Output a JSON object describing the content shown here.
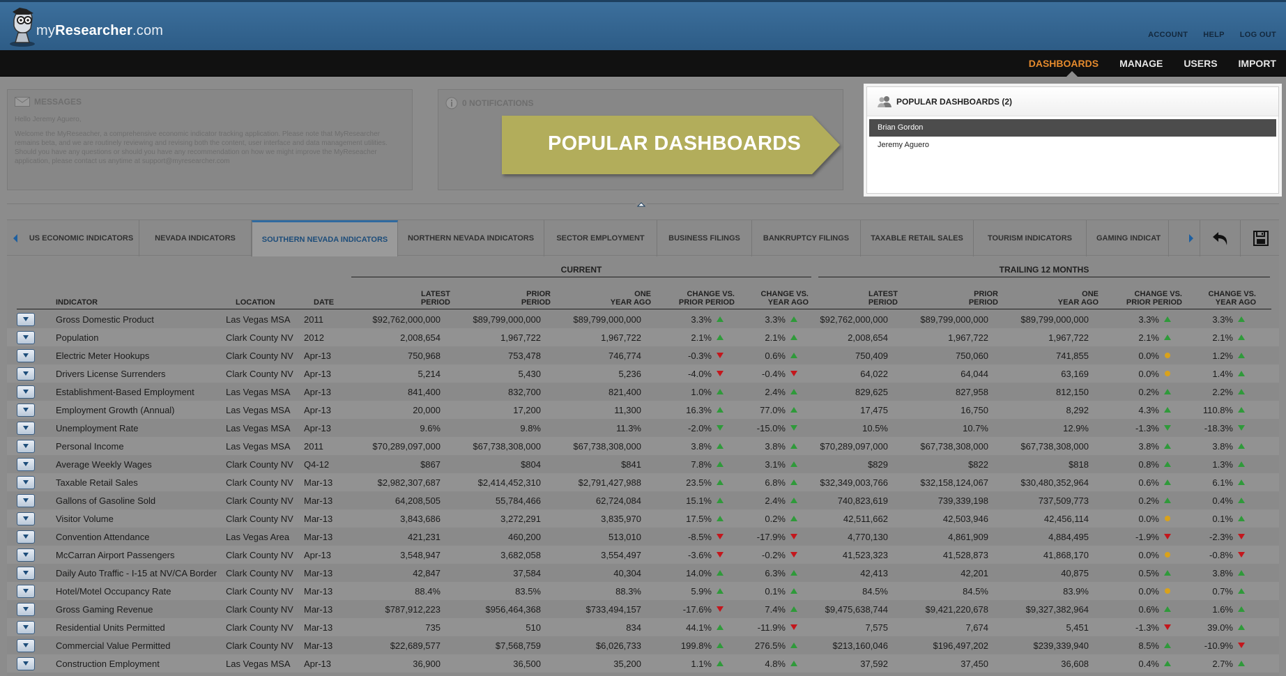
{
  "header": {
    "logo_prefix": "my",
    "logo_brand": "Researcher",
    "logo_suffix": ".com",
    "top_links": [
      "ACCOUNT",
      "HELP",
      "LOG OUT"
    ]
  },
  "nav": {
    "items": [
      "DASHBOARDS",
      "MANAGE",
      "USERS",
      "IMPORT"
    ],
    "active": "DASHBOARDS"
  },
  "messages": {
    "title": "MESSAGES",
    "greeting": "Hello Jeremy Aguero,",
    "body": "Welcome the MyReseacher, a comprehensive economic indicator tracking application. Please note that MyResearcher remains beta, and we are routinely reviewing and revising both the content, user interface and data management utilities. Should you have any questions or should you have any recommendation on how we might improve the MyReseacher application, please contact us anytime at support@myresearcher.com"
  },
  "notifications": {
    "title": "0 NOTIFICATIONS"
  },
  "callout": {
    "text": "POPULAR DASHBOARDS"
  },
  "popular": {
    "title": "POPULAR DASHBOARDS (2)",
    "items": [
      "Brian Gordon",
      "Jeremy Aguero"
    ]
  },
  "tabs": [
    "US ECONOMIC INDICATORS",
    "NEVADA INDICATORS",
    "SOUTHERN NEVADA INDICATORS",
    "NORTHERN NEVADA INDICATORS",
    "SECTOR EMPLOYMENT",
    "BUSINESS FILINGS",
    "BANKRUPTCY FILINGS",
    "TAXABLE RETAIL SALES",
    "TOURISM INDICATORS",
    "GAMING INDICAT"
  ],
  "active_tab": 2,
  "table": {
    "group_current": "CURRENT",
    "group_trailing": "TRAILING 12 MONTHS",
    "columns": {
      "indicator": "INDICATOR",
      "location": "LOCATION",
      "date": "DATE",
      "latest_1": "LATEST",
      "latest_2": "PERIOD",
      "prior_1": "PRIOR",
      "prior_2": "PERIOD",
      "oneyear_1": "ONE",
      "oneyear_2": "YEAR AGO",
      "chgprior_1": "CHANGE VS.",
      "chgprior_2": "PRIOR PERIOD",
      "chgyear_1": "CHANGE VS.",
      "chgyear_2": "YEAR AGO"
    },
    "rows": [
      {
        "name": "Gross Domestic Product",
        "loc": "Las Vegas MSA",
        "date": "2011",
        "c": [
          "$92,762,000,000",
          "$89,799,000,000",
          "$89,799,000,000",
          "3.3%",
          "3.3%"
        ],
        "ci": [
          "up",
          "up"
        ],
        "t": [
          "$92,762,000,000",
          "$89,799,000,000",
          "$89,799,000,000",
          "3.3%",
          "3.3%"
        ],
        "ti": [
          "up",
          "up"
        ]
      },
      {
        "name": "Population",
        "loc": "Clark County NV",
        "date": "2012",
        "c": [
          "2,008,654",
          "1,967,722",
          "1,967,722",
          "2.1%",
          "2.1%"
        ],
        "ci": [
          "up",
          "up"
        ],
        "t": [
          "2,008,654",
          "1,967,722",
          "1,967,722",
          "2.1%",
          "2.1%"
        ],
        "ti": [
          "up",
          "up"
        ]
      },
      {
        "name": "Electric Meter Hookups",
        "loc": "Clark County NV",
        "date": "Apr-13",
        "c": [
          "750,968",
          "753,478",
          "746,774",
          "-0.3%",
          "0.6%"
        ],
        "ci": [
          "down-red",
          "up"
        ],
        "t": [
          "750,409",
          "750,060",
          "741,855",
          "0.0%",
          "1.2%"
        ],
        "ti": [
          "flat",
          "up"
        ]
      },
      {
        "name": "Drivers License Surrenders",
        "loc": "Clark County NV",
        "date": "Apr-13",
        "c": [
          "5,214",
          "5,430",
          "5,236",
          "-4.0%",
          "-0.4%"
        ],
        "ci": [
          "down-red",
          "down-red"
        ],
        "t": [
          "64,022",
          "64,044",
          "63,169",
          "0.0%",
          "1.4%"
        ],
        "ti": [
          "flat",
          "up"
        ]
      },
      {
        "name": "Establishment-Based Employment",
        "loc": "Las Vegas MSA",
        "date": "Apr-13",
        "c": [
          "841,400",
          "832,700",
          "821,400",
          "1.0%",
          "2.4%"
        ],
        "ci": [
          "up",
          "up"
        ],
        "t": [
          "829,625",
          "827,958",
          "812,150",
          "0.2%",
          "2.2%"
        ],
        "ti": [
          "up",
          "up"
        ]
      },
      {
        "name": "Employment Growth (Annual)",
        "loc": "Las Vegas MSA",
        "date": "Apr-13",
        "c": [
          "20,000",
          "17,200",
          "11,300",
          "16.3%",
          "77.0%"
        ],
        "ci": [
          "up",
          "up"
        ],
        "t": [
          "17,475",
          "16,750",
          "8,292",
          "4.3%",
          "110.8%"
        ],
        "ti": [
          "up",
          "up"
        ]
      },
      {
        "name": "Unemployment Rate",
        "loc": "Las Vegas MSA",
        "date": "Apr-13",
        "c": [
          "9.6%",
          "9.8%",
          "11.3%",
          "-2.0%",
          "-15.0%"
        ],
        "ci": [
          "down-green",
          "down-green"
        ],
        "t": [
          "10.5%",
          "10.7%",
          "12.9%",
          "-1.3%",
          "-18.3%"
        ],
        "ti": [
          "down-green",
          "down-green"
        ]
      },
      {
        "name": "Personal Income",
        "loc": "Las Vegas MSA",
        "date": "2011",
        "c": [
          "$70,289,097,000",
          "$67,738,308,000",
          "$67,738,308,000",
          "3.8%",
          "3.8%"
        ],
        "ci": [
          "up",
          "up"
        ],
        "t": [
          "$70,289,097,000",
          "$67,738,308,000",
          "$67,738,308,000",
          "3.8%",
          "3.8%"
        ],
        "ti": [
          "up",
          "up"
        ]
      },
      {
        "name": "Average Weekly Wages",
        "loc": "Clark County NV",
        "date": "Q4-12",
        "c": [
          "$867",
          "$804",
          "$841",
          "7.8%",
          "3.1%"
        ],
        "ci": [
          "up",
          "up"
        ],
        "t": [
          "$829",
          "$822",
          "$818",
          "0.8%",
          "1.3%"
        ],
        "ti": [
          "up",
          "up"
        ]
      },
      {
        "name": "Taxable Retail Sales",
        "loc": "Clark County NV",
        "date": "Mar-13",
        "c": [
          "$2,982,307,687",
          "$2,414,452,310",
          "$2,791,427,988",
          "23.5%",
          "6.8%"
        ],
        "ci": [
          "up",
          "up"
        ],
        "t": [
          "$32,349,003,766",
          "$32,158,124,067",
          "$30,480,352,964",
          "0.6%",
          "6.1%"
        ],
        "ti": [
          "up",
          "up"
        ]
      },
      {
        "name": "Gallons of Gasoline Sold",
        "loc": "Clark County NV",
        "date": "Mar-13",
        "c": [
          "64,208,505",
          "55,784,466",
          "62,724,084",
          "15.1%",
          "2.4%"
        ],
        "ci": [
          "up",
          "up"
        ],
        "t": [
          "740,823,619",
          "739,339,198",
          "737,509,773",
          "0.2%",
          "0.4%"
        ],
        "ti": [
          "up",
          "up"
        ]
      },
      {
        "name": "Visitor Volume",
        "loc": "Clark County NV",
        "date": "Mar-13",
        "c": [
          "3,843,686",
          "3,272,291",
          "3,835,970",
          "17.5%",
          "0.2%"
        ],
        "ci": [
          "up",
          "up"
        ],
        "t": [
          "42,511,662",
          "42,503,946",
          "42,456,114",
          "0.0%",
          "0.1%"
        ],
        "ti": [
          "flat",
          "up"
        ]
      },
      {
        "name": "Convention Attendance",
        "loc": "Las Vegas Area",
        "date": "Mar-13",
        "c": [
          "421,231",
          "460,200",
          "513,010",
          "-8.5%",
          "-17.9%"
        ],
        "ci": [
          "down-red",
          "down-red"
        ],
        "t": [
          "4,770,130",
          "4,861,909",
          "4,884,495",
          "-1.9%",
          "-2.3%"
        ],
        "ti": [
          "down-red",
          "down-red"
        ]
      },
      {
        "name": "McCarran Airport Passengers",
        "loc": "Clark County NV",
        "date": "Apr-13",
        "c": [
          "3,548,947",
          "3,682,058",
          "3,554,497",
          "-3.6%",
          "-0.2%"
        ],
        "ci": [
          "down-red",
          "down-red"
        ],
        "t": [
          "41,523,323",
          "41,528,873",
          "41,868,170",
          "0.0%",
          "-0.8%"
        ],
        "ti": [
          "flat",
          "down-red"
        ]
      },
      {
        "name": "Daily Auto Traffic - I-15 at NV/CA Border",
        "loc": "Clark County NV",
        "date": "Mar-13",
        "c": [
          "42,847",
          "37,584",
          "40,304",
          "14.0%",
          "6.3%"
        ],
        "ci": [
          "up",
          "up"
        ],
        "t": [
          "42,413",
          "42,201",
          "40,875",
          "0.5%",
          "3.8%"
        ],
        "ti": [
          "up",
          "up"
        ]
      },
      {
        "name": "Hotel/Motel Occupancy Rate",
        "loc": "Clark County NV",
        "date": "Mar-13",
        "c": [
          "88.4%",
          "83.5%",
          "88.3%",
          "5.9%",
          "0.1%"
        ],
        "ci": [
          "up",
          "up"
        ],
        "t": [
          "84.5%",
          "84.5%",
          "83.9%",
          "0.0%",
          "0.7%"
        ],
        "ti": [
          "flat",
          "up"
        ]
      },
      {
        "name": "Gross Gaming Revenue",
        "loc": "Clark County NV",
        "date": "Mar-13",
        "c": [
          "$787,912,223",
          "$956,464,368",
          "$733,494,157",
          "-17.6%",
          "7.4%"
        ],
        "ci": [
          "down-red",
          "up"
        ],
        "t": [
          "$9,475,638,744",
          "$9,421,220,678",
          "$9,327,382,964",
          "0.6%",
          "1.6%"
        ],
        "ti": [
          "up",
          "up"
        ]
      },
      {
        "name": "Residential Units Permitted",
        "loc": "Clark County NV",
        "date": "Mar-13",
        "c": [
          "735",
          "510",
          "834",
          "44.1%",
          "-11.9%"
        ],
        "ci": [
          "up",
          "down-red"
        ],
        "t": [
          "7,575",
          "7,674",
          "5,451",
          "-1.3%",
          "39.0%"
        ],
        "ti": [
          "down-red",
          "up"
        ]
      },
      {
        "name": "Commercial Value Permitted",
        "loc": "Clark County NV",
        "date": "Mar-13",
        "c": [
          "$22,689,577",
          "$7,568,759",
          "$6,026,733",
          "199.8%",
          "276.5%"
        ],
        "ci": [
          "up",
          "up"
        ],
        "t": [
          "$213,160,046",
          "$196,497,202",
          "$239,339,940",
          "8.5%",
          "-10.9%"
        ],
        "ti": [
          "up",
          "down-red"
        ]
      },
      {
        "name": "Construction Employment",
        "loc": "Las Vegas MSA",
        "date": "Apr-13",
        "c": [
          "36,900",
          "36,500",
          "35,200",
          "1.1%",
          "4.8%"
        ],
        "ci": [
          "up",
          "up"
        ],
        "t": [
          "37,592",
          "37,450",
          "36,608",
          "0.4%",
          "2.7%"
        ],
        "ti": [
          "up",
          "up"
        ]
      }
    ]
  },
  "colors": {
    "up": "#2f9a3a",
    "down_red": "#c4161c",
    "down_green": "#2f9a3a",
    "flat": "#d9a21b",
    "accent": "#e58a2d",
    "tab_active": "#1d4d7a"
  },
  "icons": {
    "expand": "chevron-down-icon",
    "undo": "undo-icon",
    "save": "save-icon"
  }
}
